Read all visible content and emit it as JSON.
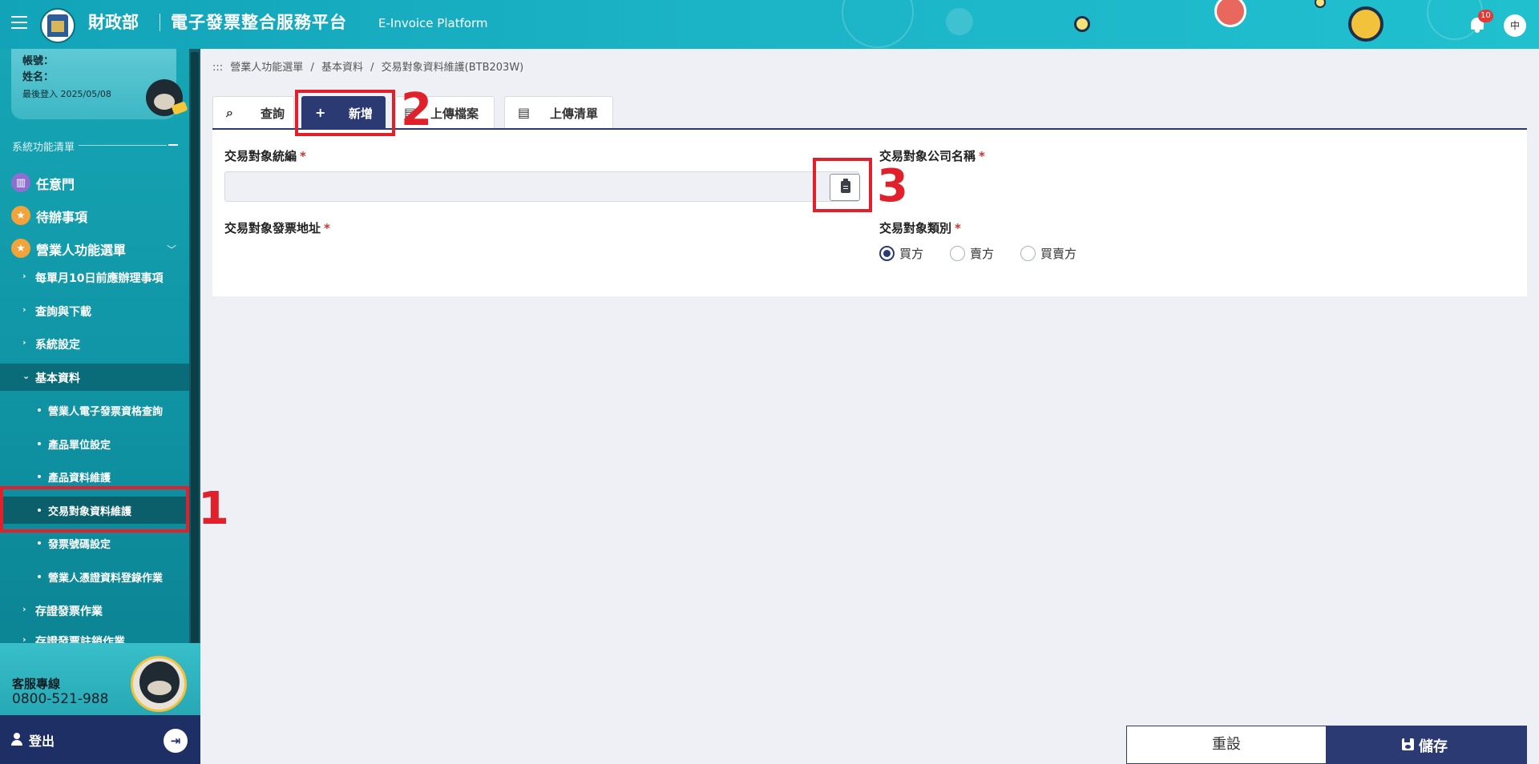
{
  "header": {
    "org": "財政部",
    "title": "電子發票整合服務平台",
    "title_en": "E-Invoice Platform",
    "notification_count": "10",
    "lang": "中"
  },
  "user": {
    "account_label": "帳號：",
    "name_label": "姓名：",
    "last_login": "最後登入 2025/05/08"
  },
  "sidebar": {
    "section_title": "系統功能清單",
    "top_items": [
      {
        "label": "任意門",
        "icon": "map-icon",
        "color": "#8e6fd1"
      },
      {
        "label": "待辦事項",
        "icon": "star-icon",
        "color": "#f2a33a"
      },
      {
        "label": "營業人功能選單",
        "icon": "star-icon",
        "color": "#f2a33a"
      }
    ],
    "sub_items": [
      "每單月10日前應辦理事項",
      "查詢與下載",
      "系統設定",
      "基本資料"
    ],
    "leaf_items": [
      "營業人電子發票資格查詢",
      "產品單位設定",
      "產品資料維護",
      "交易對象資料維護",
      "發票號碼設定",
      "營業人憑證資料登錄作業"
    ],
    "after_items": [
      "存證發票作業",
      "存證發票註銷作業"
    ],
    "hotline_label": "客服專線",
    "hotline_number": "0800-521-988",
    "logout_label": "登出"
  },
  "breadcrumb": {
    "prefix": ":::",
    "items": [
      "營業人功能選單",
      "基本資料",
      "交易對象資料維護(BTB203W)"
    ],
    "separator": "/"
  },
  "tabs": [
    {
      "label": "查詢",
      "icon": "search-icon"
    },
    {
      "label": "新增",
      "icon": "plus-icon",
      "active": true
    },
    {
      "label": "上傳檔案",
      "icon": "file-icon"
    },
    {
      "label": "上傳清單",
      "icon": "file-upload-icon"
    }
  ],
  "form": {
    "tax_id_label": "交易對象統編",
    "company_name_label": "交易對象公司名稱",
    "address_label": "交易對象發票地址",
    "type_label": "交易對象類別",
    "required_mark": "*",
    "tax_id_value": "",
    "type_options": [
      "買方",
      "賣方",
      "買賣方"
    ],
    "type_selected": "買方"
  },
  "actions": {
    "reset_label": "重設",
    "save_label": "儲存"
  },
  "annotations": [
    "1",
    "2",
    "3"
  ],
  "colors": {
    "primary": "#2b3a73",
    "teal": "#16a6b6",
    "annotation": "#e0202a",
    "required": "#d32f2f"
  }
}
